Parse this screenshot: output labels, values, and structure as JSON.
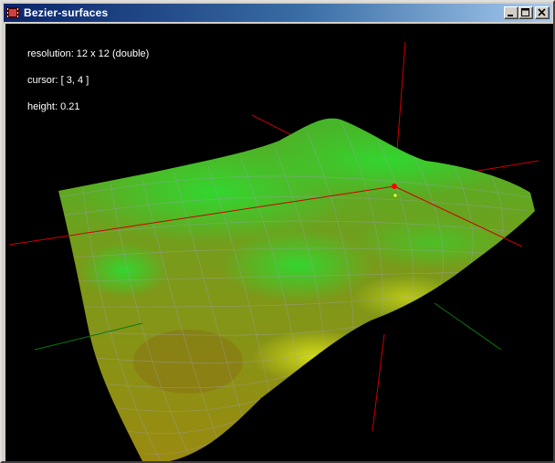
{
  "window": {
    "title": "Bezier-surfaces"
  },
  "overlay": {
    "resolution": "resolution: 12 x 12 (double)",
    "cursor": "cursor: [ 3, 4 ]",
    "height": "height: 0.21"
  },
  "colors": {
    "titlebar_start": "#0a246a",
    "titlebar_end": "#a6caf0",
    "viewport_background": "#000000",
    "surface_green": "#2ecc2e",
    "surface_olive": "#9a8a10",
    "surface_yellow": "#c8d010",
    "axis_red": "#cc0000",
    "axis_green": "#0a7a0a",
    "grid_line": "#9a9ab4",
    "cursor_marker": "#ff0000"
  },
  "icons": {
    "app": "film-icon",
    "minimize": "minimize-icon",
    "maximize": "maximize-icon",
    "close": "close-icon"
  }
}
